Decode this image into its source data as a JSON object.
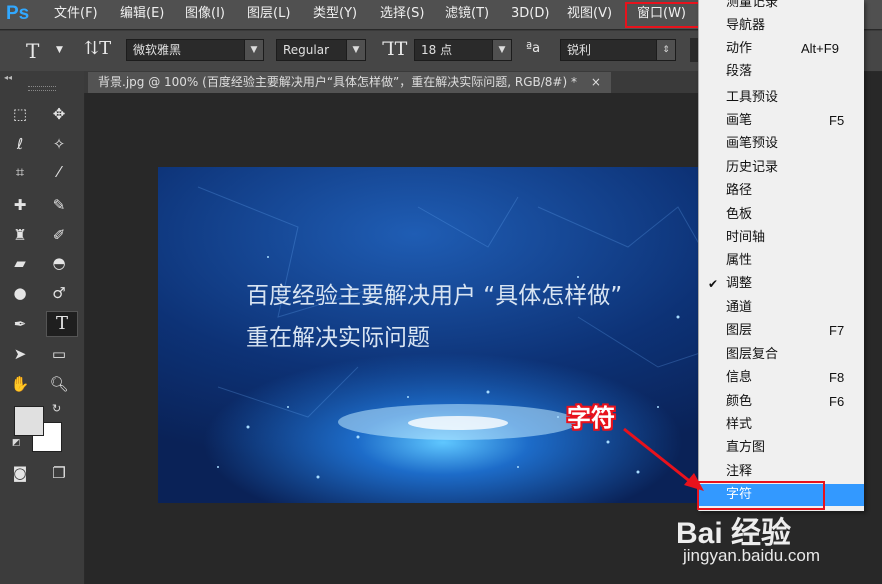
{
  "app": {
    "logo": "Ps"
  },
  "menubar": {
    "items": [
      "文件(F)",
      "编辑(E)",
      "图像(I)",
      "图层(L)",
      "类型(Y)",
      "选择(S)",
      "滤镜(T)",
      "3D(D)",
      "视图(V)",
      "窗口(W)"
    ]
  },
  "options": {
    "font_family": "微软雅黑",
    "font_style": "Regular",
    "font_size": "18 点",
    "aa_label": "ªa",
    "antialias": "锐利"
  },
  "document": {
    "tab_title": "背景.jpg @ 100% (百度经验主要解决用户“具体怎样做”，重在解决实际问题, RGB/8#) *",
    "close": "×"
  },
  "canvas": {
    "line1": "百度经验主要解决用户 “具体怎样做”",
    "line2": "重在解决实际问题"
  },
  "window_menu": {
    "items": [
      {
        "label": "测量记录",
        "key": ""
      },
      {
        "label": "导航器",
        "key": ""
      },
      {
        "label": "动作",
        "key": "Alt+F9"
      },
      {
        "label": "段落",
        "key": ""
      },
      {
        "label": "工具预设",
        "key": ""
      },
      {
        "label": "画笔",
        "key": "F5"
      },
      {
        "label": "画笔预设",
        "key": ""
      },
      {
        "label": "历史记录",
        "key": ""
      },
      {
        "label": "路径",
        "key": ""
      },
      {
        "label": "色板",
        "key": ""
      },
      {
        "label": "时间轴",
        "key": ""
      },
      {
        "label": "属性",
        "key": ""
      },
      {
        "label": "调整",
        "key": "",
        "checked": "✔"
      },
      {
        "label": "通道",
        "key": ""
      },
      {
        "label": "图层",
        "key": "F7"
      },
      {
        "label": "图层复合",
        "key": ""
      },
      {
        "label": "信息",
        "key": "F8"
      },
      {
        "label": "颜色",
        "key": "F6"
      },
      {
        "label": "样式",
        "key": ""
      },
      {
        "label": "直方图",
        "key": ""
      },
      {
        "label": "注释",
        "key": ""
      },
      {
        "label": "字符",
        "key": ""
      }
    ]
  },
  "annotation": {
    "label": "字符"
  },
  "watermark": {
    "logo": "Bai 经验",
    "url": "jingyan.baidu.com"
  },
  "colors": {
    "highlight": "#3399ff",
    "annotation_red": "#e8121c",
    "ps_blue": "#31a8ff"
  }
}
